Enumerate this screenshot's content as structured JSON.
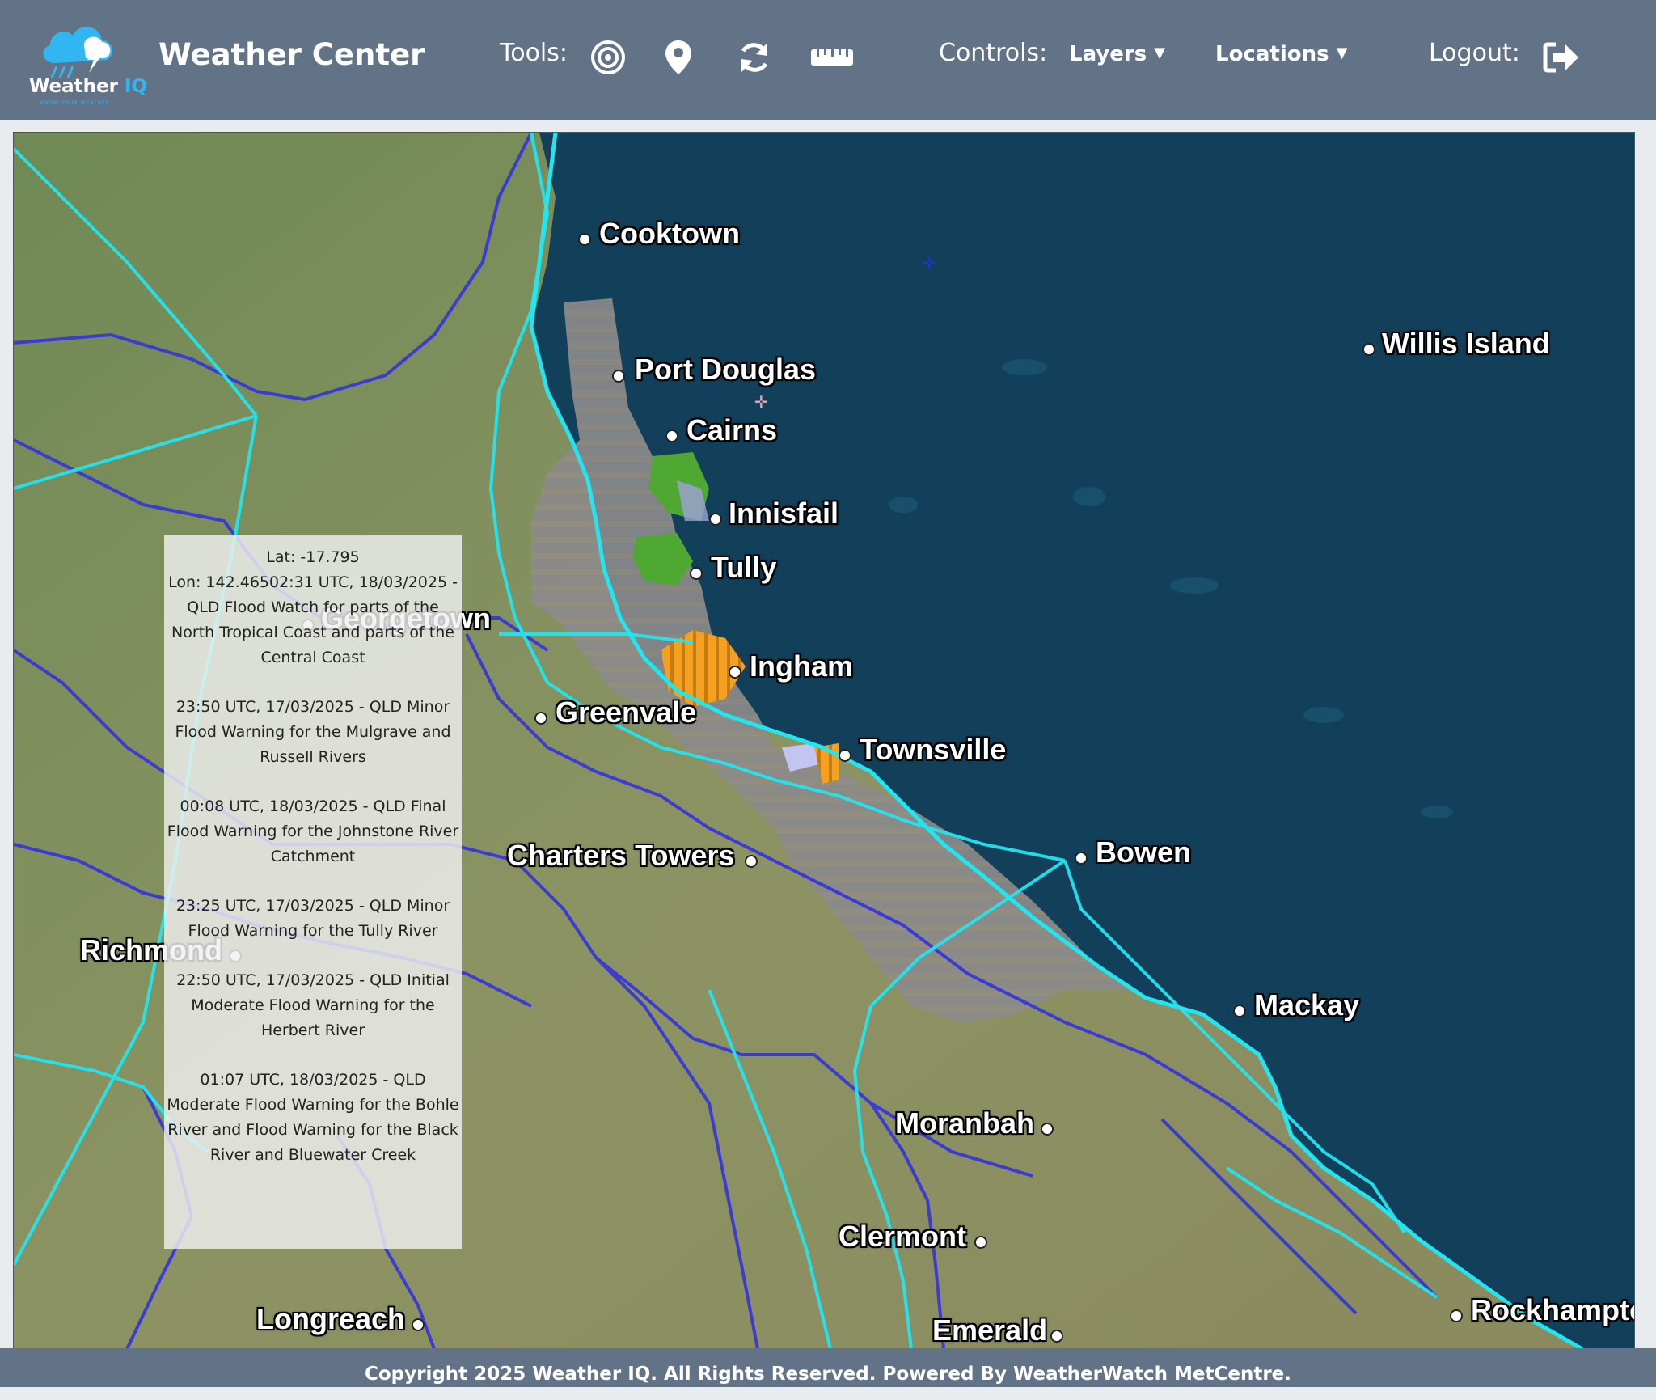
{
  "header": {
    "logo_text_a": "Weather ",
    "logo_text_b": "IQ",
    "logo_tagline": "KNOW YOUR WEATHER",
    "app_title": "Weather Center",
    "tools_label": "Tools:",
    "tools": [
      {
        "name": "target-icon"
      },
      {
        "name": "map-pin-icon"
      },
      {
        "name": "refresh-icon"
      },
      {
        "name": "ruler-icon"
      }
    ],
    "controls_label": "Controls:",
    "layers_label": "Layers",
    "locations_label": "Locations",
    "logout_label": "Logout:",
    "logout_icon": "logout-icon"
  },
  "map": {
    "cities": [
      {
        "name": "Cooktown"
      },
      {
        "name": "Port Douglas"
      },
      {
        "name": "Cairns"
      },
      {
        "name": "Willis Island"
      },
      {
        "name": "Innisfail"
      },
      {
        "name": "Tully"
      },
      {
        "name": "Georgetown"
      },
      {
        "name": "Ingham"
      },
      {
        "name": "Greenvale"
      },
      {
        "name": "Townsville"
      },
      {
        "name": "Charters Towers"
      },
      {
        "name": "Bowen"
      },
      {
        "name": "Richmond"
      },
      {
        "name": "Mackay"
      },
      {
        "name": "Moranbah"
      },
      {
        "name": "Clermont"
      },
      {
        "name": "Longreach"
      },
      {
        "name": "Emerald"
      },
      {
        "name": "Rockhampton"
      }
    ],
    "colors": {
      "ocean": "#123f5a",
      "land": "#7d8a57",
      "catchment_line": "#3333dd",
      "district_line": "#22e5f0",
      "flood_watch": "#8a8a8a",
      "minor_flood": "#4fa832",
      "moderate_flood": "#f5a020",
      "final_flood": "#b7b9ea"
    }
  },
  "info_panel": {
    "coords": "Lat: -17.795",
    "entries": [
      "Lon: 142.46502:31 UTC, 18/03/2025 - QLD Flood Watch for parts of the North Tropical Coast and parts of the Central Coast",
      "23:50 UTC, 17/03/2025 - QLD Minor Flood Warning for the Mulgrave and Russell Rivers",
      "00:08 UTC, 18/03/2025 - QLD Final Flood Warning for the Johnstone River Catchment",
      "23:25 UTC, 17/03/2025 - QLD Minor Flood Warning for the Tully River",
      "22:50 UTC, 17/03/2025 - QLD Initial Moderate Flood Warning for the Herbert River",
      "01:07 UTC, 18/03/2025 - QLD Moderate Flood Warning for the Bohle River and Flood Warning for the Black River and Bluewater Creek"
    ]
  },
  "footer": {
    "copyright": "Copyright 2025 Weather IQ. All Rights Reserved. Powered By WeatherWatch MetCentre."
  }
}
